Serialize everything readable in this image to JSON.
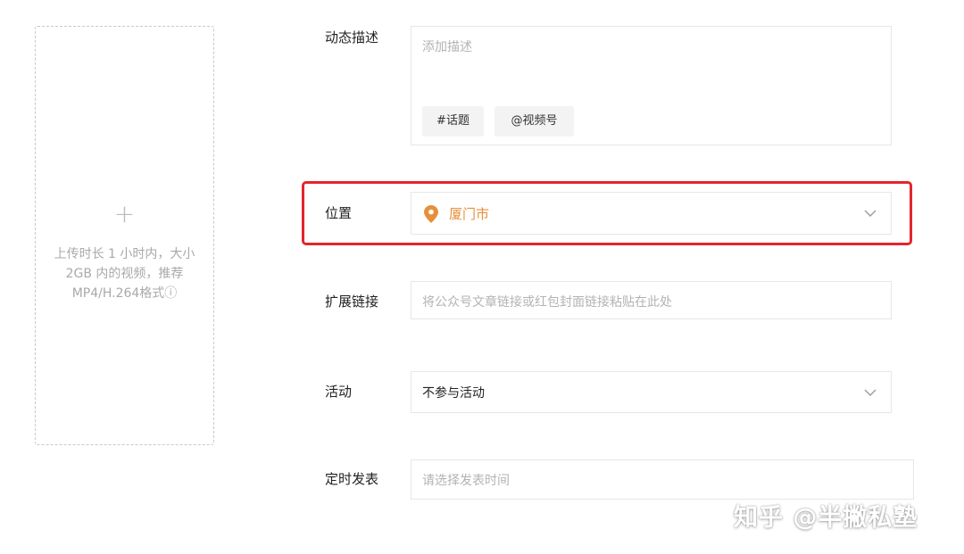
{
  "upload": {
    "plus": "+",
    "hint": "上传时长 1 小时内，大小 2GB 内的视频，推荐MP4/H.264格式ⓘ"
  },
  "description": {
    "label": "动态描述",
    "placeholder": "添加描述",
    "tags": [
      "#话题",
      "@视频号"
    ]
  },
  "location": {
    "label": "位置",
    "value": "厦门市",
    "icon": "location-pin-icon"
  },
  "link": {
    "label": "扩展链接",
    "placeholder": "将公众号文章链接或红包封面链接粘贴在此处"
  },
  "activity": {
    "label": "活动",
    "value": "不参与活动"
  },
  "schedule": {
    "label": "定时发表",
    "placeholder": "请选择发表时间"
  },
  "watermark": "知乎 @半撇私塾",
  "colors": {
    "highlight": "#e3262e",
    "location_accent": "#e5903a"
  }
}
